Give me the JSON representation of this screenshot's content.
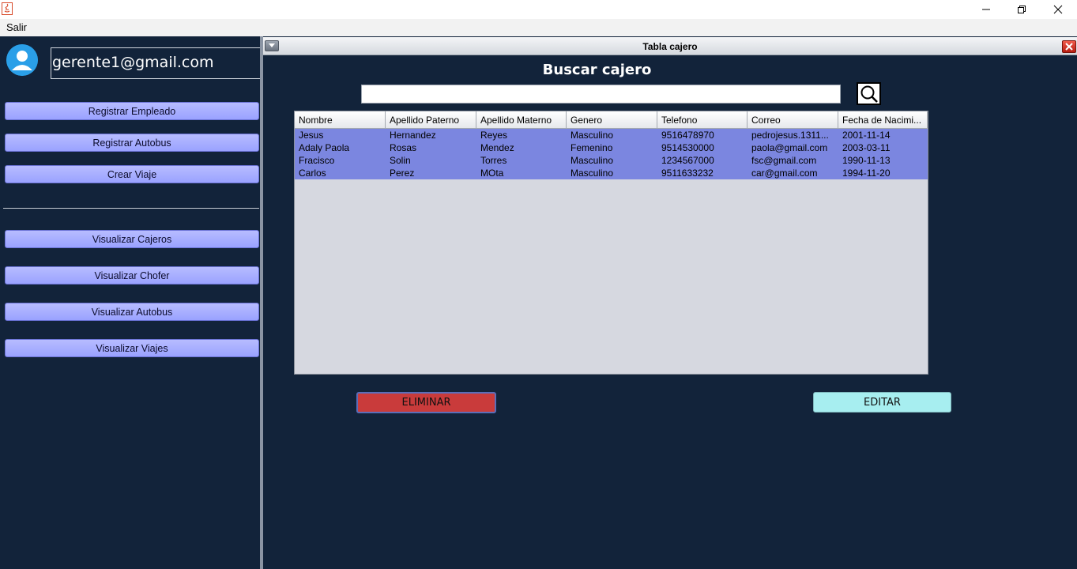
{
  "window": {
    "minimize_icon": "minimize-icon",
    "maximize_icon": "restore-icon",
    "close_icon": "close-icon"
  },
  "menubar": {
    "salir_label": "Salir"
  },
  "sidebar": {
    "user_email": "gerente1@gmail.com",
    "buttons": [
      "Registrar Empleado",
      "Registrar Autobus",
      "Crear Viaje",
      "Visualizar Cajeros",
      "Visualizar Chofer",
      "Visualizar Autobus",
      "Visualizar Viajes"
    ]
  },
  "frame": {
    "title": "Tabla cajero",
    "heading": "Buscar cajero",
    "search_value": "",
    "columns": [
      "Nombre",
      "Apellido Paterno",
      "Apellido Materno",
      "Genero",
      "Telefono",
      "Correo",
      "Fecha de Nacimi..."
    ],
    "rows": [
      [
        "Jesus",
        "Hernandez",
        "Reyes",
        "Masculino",
        "9516478970",
        "pedrojesus.1311...",
        "2001-11-14"
      ],
      [
        "Adaly Paola",
        "Rosas",
        "Mendez",
        "Femenino",
        "9514530000",
        "paola@gmail.com",
        "2003-03-11"
      ],
      [
        "Fracisco",
        "Solin",
        "Torres",
        "Masculino",
        "1234567000",
        "fsc@gmail.com",
        "1990-11-13"
      ],
      [
        "Carlos",
        "Perez",
        "MOta",
        "Masculino",
        "9511633232",
        "car@gmail.com",
        "1994-11-20"
      ]
    ],
    "delete_label": "ELIMINAR",
    "edit_label": "EDITAR",
    "colors": {
      "delete": "#c93b3b",
      "edit": "#a7eef0",
      "selected_row": "#7b86e0"
    }
  }
}
